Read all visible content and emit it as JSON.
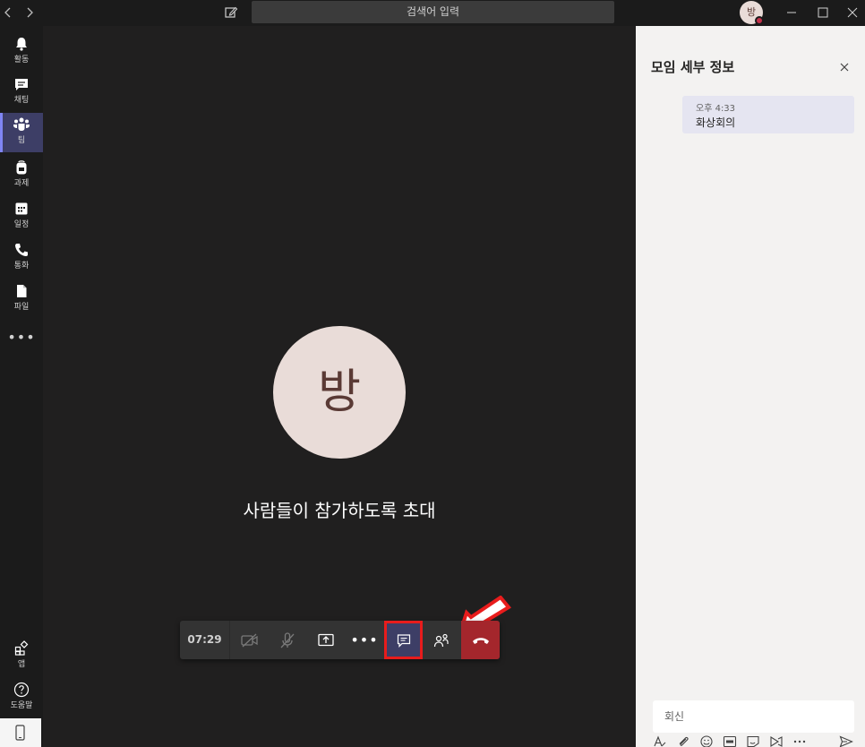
{
  "titlebar": {
    "search_placeholder": "검색어 입력",
    "avatar_initial": "방"
  },
  "rail": {
    "items": [
      {
        "label": "활동",
        "icon": "bell-icon"
      },
      {
        "label": "채팅",
        "icon": "chat-icon"
      },
      {
        "label": "팀",
        "icon": "teams-icon"
      },
      {
        "label": "과제",
        "icon": "backpack-icon"
      },
      {
        "label": "일정",
        "icon": "calendar-icon"
      },
      {
        "label": "통화",
        "icon": "phone-icon"
      },
      {
        "label": "파일",
        "icon": "file-icon"
      }
    ],
    "more": "•••",
    "apps_label": "앱",
    "help_label": "도움말"
  },
  "stage": {
    "avatar_initial": "방",
    "invite_text": "사람들이 참가하도록 초대"
  },
  "callbar": {
    "timer": "07:29",
    "more": "•••"
  },
  "panel": {
    "title": "모임 세부 정보",
    "message": {
      "time": "오후 4:33",
      "text": "화상회의"
    },
    "reply_placeholder": "회신"
  },
  "colors": {
    "accent": "#3d3e66",
    "hangup": "#a4262c",
    "highlight": "#e81c1c",
    "avatar_bg": "#e9dcd8"
  }
}
